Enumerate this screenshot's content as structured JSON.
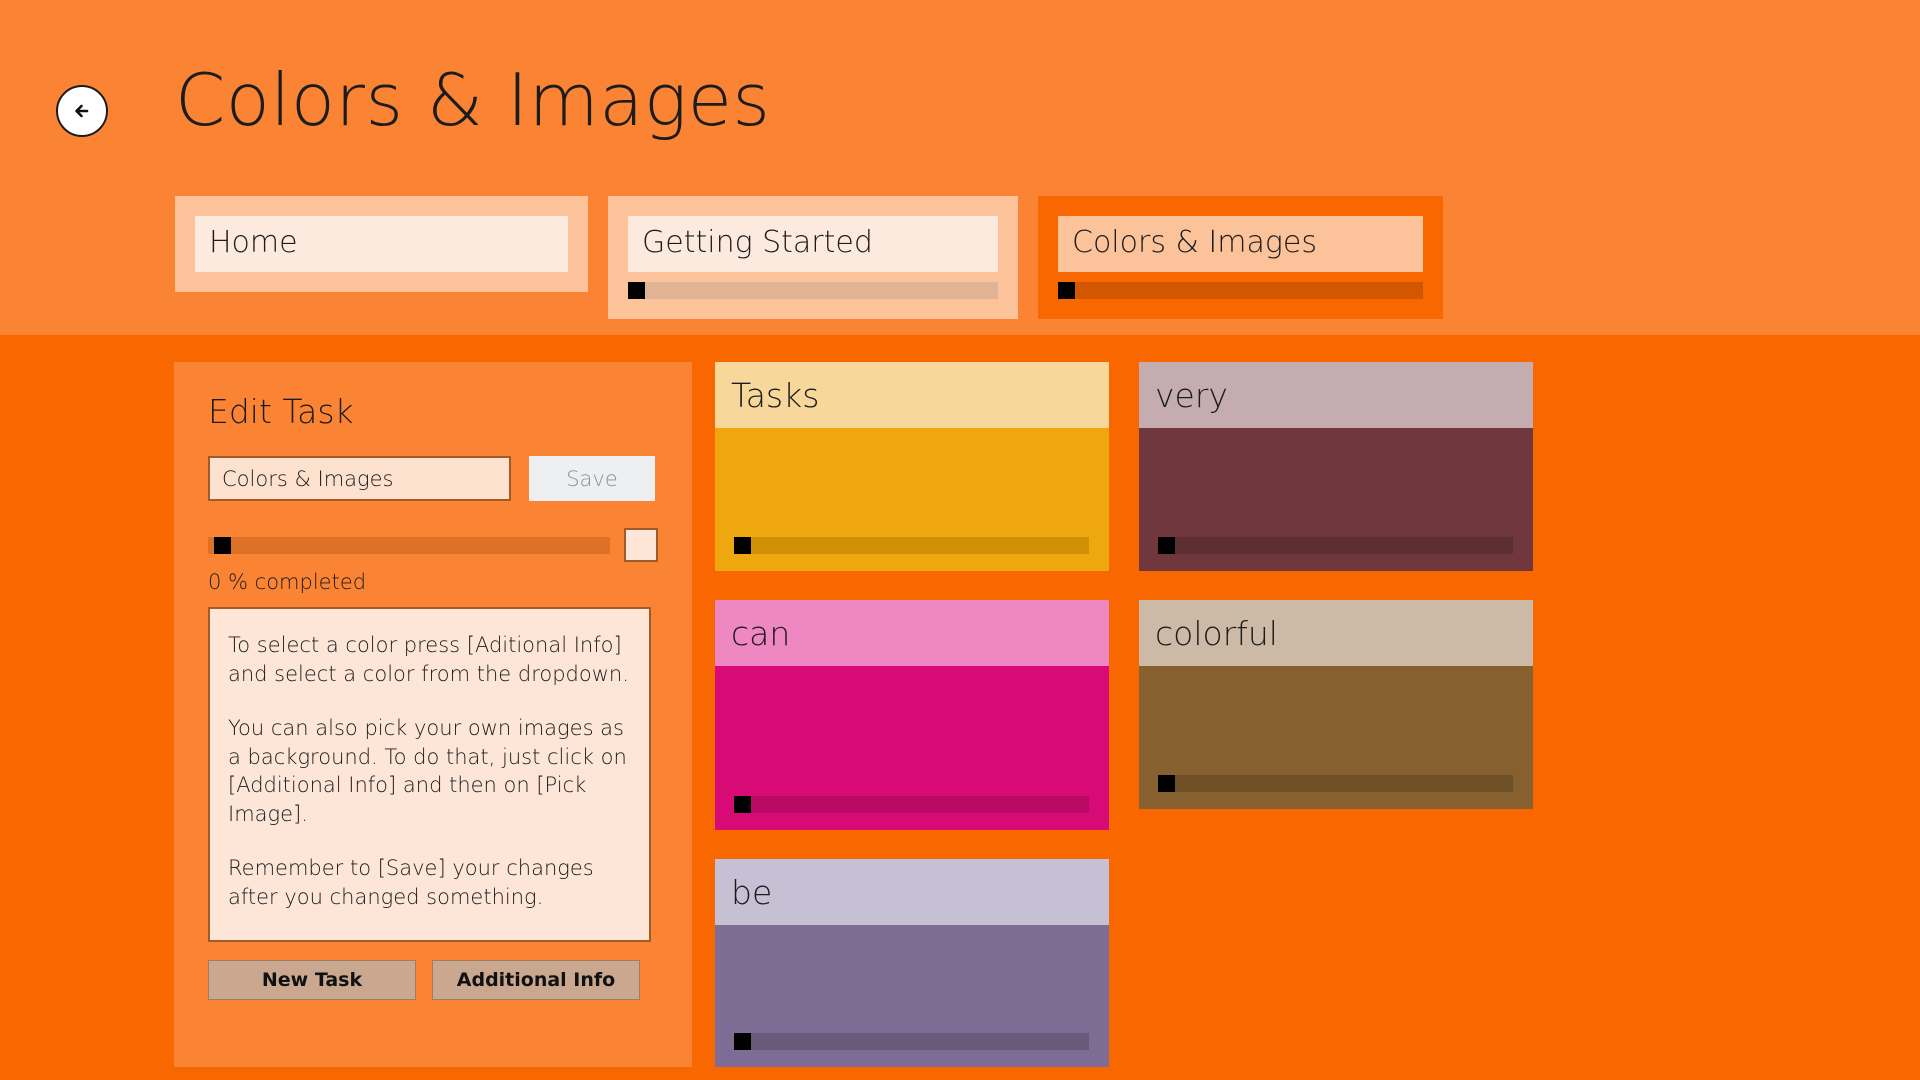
{
  "header": {
    "title": "Colors & Images",
    "back_icon": "back-arrow-icon"
  },
  "tabs": [
    {
      "label": "Home",
      "active": false,
      "has_progress_bar": false,
      "progress": 0
    },
    {
      "label": "Getting Started",
      "active": false,
      "has_progress_bar": true,
      "progress": 0
    },
    {
      "label": "Colors & Images",
      "active": true,
      "has_progress_bar": true,
      "progress": 0
    }
  ],
  "edit_panel": {
    "title": "Edit Task",
    "name_value": "Colors & Images",
    "name_placeholder": "Colors & Images",
    "save_label": "Save",
    "progress_value": 0,
    "progress_label": "0 % completed",
    "info_paragraphs": [
      "To select a color press [Aditional Info] and select a color from the dropdown.",
      "You can also pick your own images as a background. To do that, just click on [Additional Info] and then on [Pick Image].",
      "Remember to [Save] your changes after you changed something."
    ],
    "new_task_label": "New Task",
    "additional_info_label": "Additional Info"
  },
  "tiles": [
    {
      "label": "Tasks",
      "head_color": "#f8d79a",
      "body_color": "#efa70f",
      "bar_color": "#cf8f06",
      "progress": 0
    },
    {
      "label": "very",
      "head_color": "#c5acb0",
      "body_color": "#70383d",
      "bar_color": "#5d2f33",
      "progress": 0
    },
    {
      "label": "can",
      "head_color": "#ef88c2",
      "body_color": "#d80a75",
      "bar_color": "#b80963",
      "progress": 0
    },
    {
      "label": "colorful",
      "head_color": "#ccbaa7",
      "body_color": "#86602f",
      "bar_color": "#6f5027",
      "progress": 0
    },
    {
      "label": "be",
      "head_color": "#c5c0d3",
      "body_color": "#7d6c94",
      "bar_color": "#685a7b",
      "progress": 0
    }
  ],
  "colors": {
    "header_bg": "#fb8434",
    "main_bg": "#f96800",
    "panel_bg": "#fb8434",
    "active_tab_bg": "#f96800",
    "inactive_tab_bg": "#fcc29a",
    "tab_label_bg": "#fdeade",
    "input_bg": "#fce1cf",
    "input_border": "#a05b2b",
    "button_bg": "#c9a88f",
    "save_bg": "#eeeff1",
    "text": "#1c1c1c"
  }
}
